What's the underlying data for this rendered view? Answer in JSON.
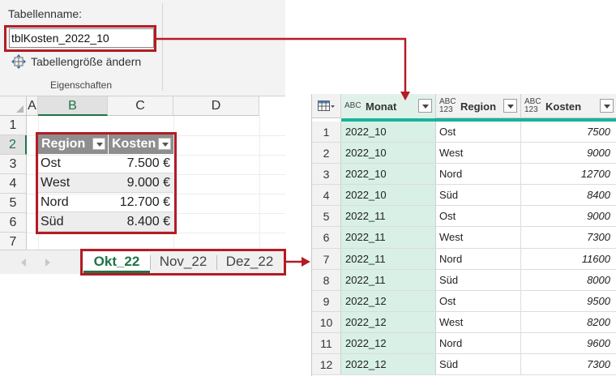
{
  "ribbon": {
    "table_name_label": "Tabellenname:",
    "table_name_value": "tblKosten_2022_10",
    "resize_label": "Tabellengröße ändern",
    "group_label": "Eigenschaften"
  },
  "sheet": {
    "columns": [
      "A",
      "B",
      "C",
      "D"
    ],
    "rows": [
      "1",
      "2",
      "3",
      "4",
      "5",
      "6",
      "7"
    ],
    "table": {
      "headers": [
        "Region",
        "Kosten"
      ],
      "rows": [
        [
          "Ost",
          "7.500 €"
        ],
        [
          "West",
          "9.000 €"
        ],
        [
          "Nord",
          "12.700 €"
        ],
        [
          "Süd",
          "8.400 €"
        ]
      ]
    },
    "tabs": [
      "Okt_22",
      "Nov_22",
      "Dez_22"
    ]
  },
  "query": {
    "headers": [
      {
        "type": "ABC",
        "name": "Monat"
      },
      {
        "type": "ABC 123",
        "name": "Region"
      },
      {
        "type": "ABC 123",
        "name": "Kosten"
      }
    ],
    "rows": [
      [
        "1",
        "2022_10",
        "Ost",
        "7500"
      ],
      [
        "2",
        "2022_10",
        "West",
        "9000"
      ],
      [
        "3",
        "2022_10",
        "Nord",
        "12700"
      ],
      [
        "4",
        "2022_10",
        "Süd",
        "8400"
      ],
      [
        "5",
        "2022_11",
        "Ost",
        "9000"
      ],
      [
        "6",
        "2022_11",
        "West",
        "7300"
      ],
      [
        "7",
        "2022_11",
        "Nord",
        "11600"
      ],
      [
        "8",
        "2022_11",
        "Süd",
        "8000"
      ],
      [
        "9",
        "2022_12",
        "Ost",
        "9500"
      ],
      [
        "10",
        "2022_12",
        "West",
        "8200"
      ],
      [
        "11",
        "2022_12",
        "Nord",
        "9600"
      ],
      [
        "12",
        "2022_12",
        "Süd",
        "7300"
      ]
    ]
  },
  "colors": {
    "highlight": "#b31c24",
    "excel_green": "#217346",
    "quality_bar": "#19b39b",
    "column_selected": "#d8f0e6"
  }
}
